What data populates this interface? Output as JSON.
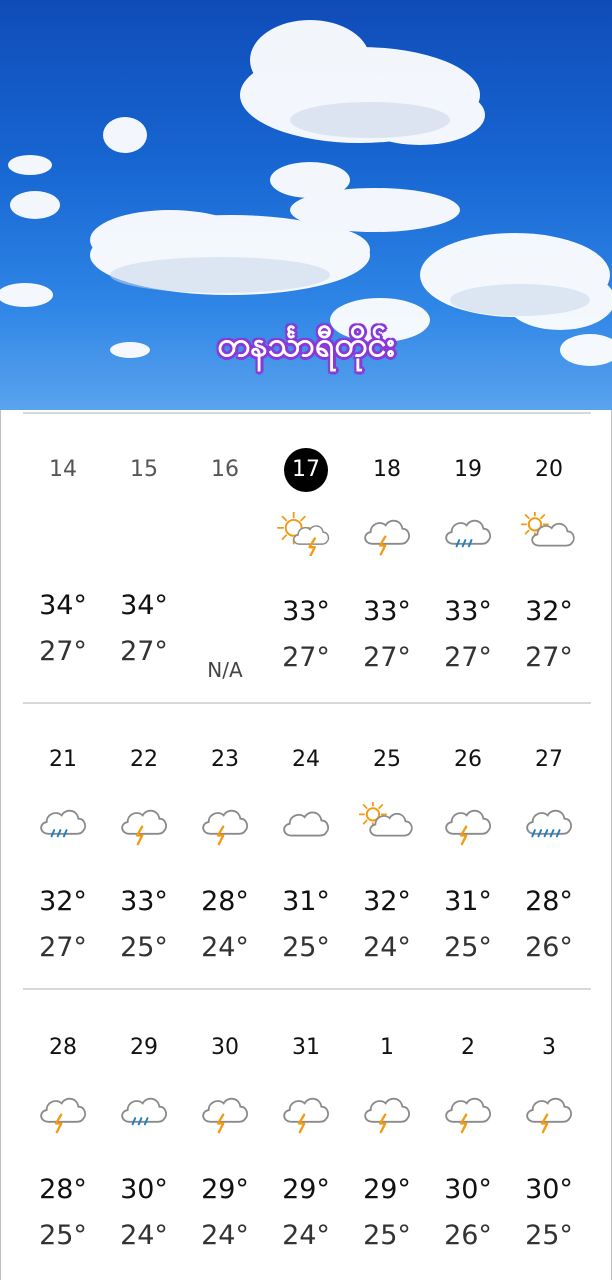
{
  "header": {
    "title": "တနင်္သာရီတိုင်း"
  },
  "colors": {
    "sun": "#f29a12",
    "bolt": "#f29a12",
    "rain": "#1f7fbf",
    "cloud": "#8a8a8a"
  },
  "weeks": [
    {
      "days": [
        {
          "date": "14",
          "state": "past",
          "icon": "",
          "hi": "34°",
          "lo": "27°"
        },
        {
          "date": "15",
          "state": "past",
          "icon": "",
          "hi": "34°",
          "lo": "27°"
        },
        {
          "date": "16",
          "state": "past",
          "icon": "",
          "hi": "",
          "lo": "",
          "na": "N/A"
        },
        {
          "date": "17",
          "state": "today",
          "icon": "sun-thunder-icon",
          "hi": "33°",
          "lo": "27°"
        },
        {
          "date": "18",
          "state": "future",
          "icon": "thunder-icon",
          "hi": "33°",
          "lo": "27°"
        },
        {
          "date": "19",
          "state": "future",
          "icon": "rain-icon",
          "hi": "33°",
          "lo": "27°"
        },
        {
          "date": "20",
          "state": "future",
          "icon": "partly-cloudy-icon",
          "hi": "32°",
          "lo": "27°"
        }
      ]
    },
    {
      "days": [
        {
          "date": "21",
          "icon": "rain-icon",
          "hi": "32°",
          "lo": "27°"
        },
        {
          "date": "22",
          "icon": "thunder-icon",
          "hi": "33°",
          "lo": "25°"
        },
        {
          "date": "23",
          "icon": "thunder-icon",
          "hi": "28°",
          "lo": "24°"
        },
        {
          "date": "24",
          "icon": "cloud-icon",
          "hi": "31°",
          "lo": "25°"
        },
        {
          "date": "25",
          "icon": "partly-cloudy-icon",
          "hi": "32°",
          "lo": "24°"
        },
        {
          "date": "26",
          "icon": "thunder-icon",
          "hi": "31°",
          "lo": "25°"
        },
        {
          "date": "27",
          "icon": "heavy-rain-icon",
          "hi": "28°",
          "lo": "26°"
        }
      ]
    },
    {
      "days": [
        {
          "date": "28",
          "icon": "thunder-icon",
          "hi": "28°",
          "lo": "25°"
        },
        {
          "date": "29",
          "icon": "rain-icon",
          "hi": "30°",
          "lo": "24°"
        },
        {
          "date": "30",
          "icon": "thunder-icon",
          "hi": "29°",
          "lo": "24°"
        },
        {
          "date": "31",
          "icon": "thunder-icon",
          "hi": "29°",
          "lo": "24°"
        },
        {
          "date": "1",
          "icon": "thunder-icon",
          "hi": "29°",
          "lo": "25°"
        },
        {
          "date": "2",
          "icon": "thunder-icon",
          "hi": "30°",
          "lo": "26°"
        },
        {
          "date": "3",
          "icon": "thunder-icon",
          "hi": "30°",
          "lo": "25°"
        }
      ]
    }
  ]
}
